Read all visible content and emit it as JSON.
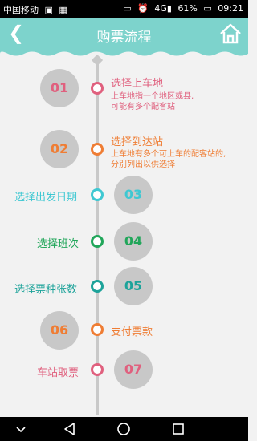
{
  "status_bar": {
    "carrier": "中国移动",
    "signal": "4G",
    "battery": "61%",
    "time": "09:21"
  },
  "header": {
    "title": "购票流程",
    "back_icon": "back-arrow-icon",
    "home_icon": "home-icon"
  },
  "steps": [
    {
      "num": "01",
      "label": "选择上车地",
      "desc1": "上车地指一个地区或县,",
      "desc2": "可能有多个配客站",
      "color": "#e0607e"
    },
    {
      "num": "02",
      "label": "选择到达站",
      "desc1": "上车地有多个可上车的配客站的,",
      "desc2": "分别列出以供选择",
      "color": "#ef7d34"
    },
    {
      "num": "03",
      "label": "选择出发日期",
      "color": "#3fc8d2"
    },
    {
      "num": "04",
      "label": "选择班次",
      "color": "#21a65a"
    },
    {
      "num": "05",
      "label": "选择票种张数",
      "color": "#1da39a"
    },
    {
      "num": "06",
      "label": "支付票款",
      "color": "#ef7d34"
    },
    {
      "num": "07",
      "label": "车站取票",
      "color": "#e0607e"
    }
  ],
  "nav_bar": {
    "back": "nav-back-icon",
    "home": "nav-home-icon",
    "recent": "nav-recent-icon",
    "menu": "nav-menu-icon"
  }
}
